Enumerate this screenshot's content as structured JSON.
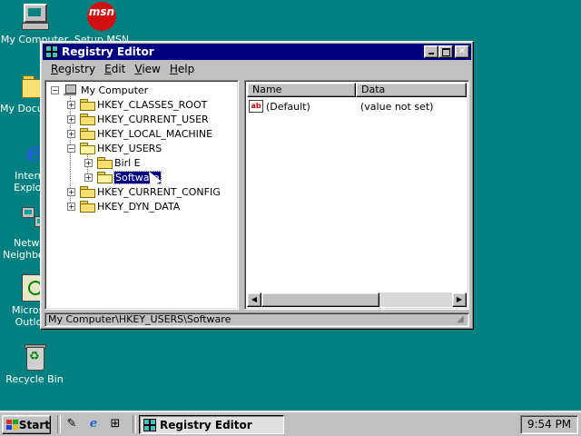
{
  "desktop": {
    "icons": [
      {
        "label": "My Computer",
        "icon": "computer-icon"
      },
      {
        "label": "Setup MSN",
        "icon": "msn-icon",
        "glyph_text": "msn"
      },
      {
        "label": "My Documents",
        "icon": "folder-icon"
      },
      {
        "label": "Internet Explorer",
        "icon": "ie-icon"
      },
      {
        "label": "Network Neighborhood",
        "icon": "network-icon"
      },
      {
        "label": "Microsoft Outlook",
        "icon": "outlook-icon"
      },
      {
        "label": "Recycle Bin",
        "icon": "recycle-bin-icon"
      }
    ]
  },
  "window": {
    "title": "Registry Editor",
    "menu": [
      {
        "label": "Registry",
        "key": "R"
      },
      {
        "label": "Edit",
        "key": "E"
      },
      {
        "label": "View",
        "key": "V"
      },
      {
        "label": "Help",
        "key": "H"
      }
    ],
    "tree": {
      "root": "My Computer",
      "nodes": [
        {
          "label": "HKEY_CLASSES_ROOT",
          "expander": "+"
        },
        {
          "label": "HKEY_CURRENT_USER",
          "expander": "+"
        },
        {
          "label": "HKEY_LOCAL_MACHINE",
          "expander": "+"
        },
        {
          "label": "HKEY_USERS",
          "expander": "−"
        },
        {
          "label": "Birl E",
          "expander": "+"
        },
        {
          "label": "Software",
          "expander": "+",
          "selected": true
        },
        {
          "label": "HKEY_CURRENT_CONFIG",
          "expander": "+"
        },
        {
          "label": "HKEY_DYN_DATA",
          "expander": "+"
        }
      ]
    },
    "list": {
      "columns": [
        "Name",
        "Data"
      ],
      "rows": [
        {
          "name": "(Default)",
          "data": "(value not set)",
          "icon": "ab"
        }
      ]
    },
    "status": "My Computer\\HKEY_USERS\\Software"
  },
  "taskbar": {
    "start_label": "Start",
    "task_label": "Registry Editor",
    "clock": "9:54 PM"
  },
  "colors": {
    "desktop": "#008080",
    "titlebar": "#000080",
    "face": "#c0c0c0",
    "selection": "#000080"
  }
}
